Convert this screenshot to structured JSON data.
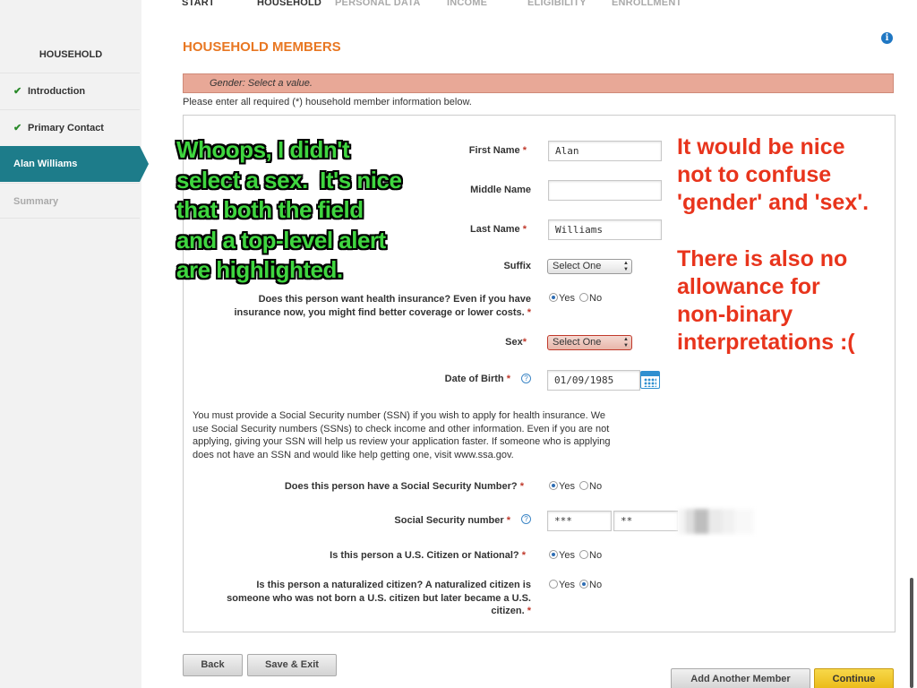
{
  "steps": [
    {
      "label": "START",
      "state": "done"
    },
    {
      "label": "HOUSEHOLD",
      "state": "done"
    },
    {
      "label": "PERSONAL DATA",
      "state": "todo"
    },
    {
      "label": "INCOME",
      "state": "todo"
    },
    {
      "label": "ELIGIBILITY",
      "state": "todo"
    },
    {
      "label": "ENROLLMENT",
      "state": "todo"
    }
  ],
  "sidebar": {
    "title": "HOUSEHOLD",
    "items": [
      {
        "label": "Introduction",
        "icon": "check-icon",
        "state": "complete"
      },
      {
        "label": "Primary Contact",
        "icon": "check-icon",
        "state": "complete"
      },
      {
        "label": "Alan Williams",
        "state": "active"
      },
      {
        "label": "Summary",
        "state": "disabled"
      }
    ]
  },
  "page": {
    "title": "HOUSEHOLD MEMBERS",
    "info_icon": "i",
    "alert": "Gender: Select a value.",
    "intro": "Please enter all required (*) household member information below."
  },
  "form": {
    "first_name": {
      "label": "First Name",
      "value": "Alan"
    },
    "middle_name": {
      "label": "Middle Name",
      "value": ""
    },
    "last_name": {
      "label": "Last Name",
      "value": "Williams"
    },
    "suffix": {
      "label": "Suffix",
      "value": "Select One"
    },
    "health_insurance": {
      "label_line1": "Does this person want health insurance? Even if you have",
      "label_line2": "insurance now, you might find better coverage or lower costs.",
      "selected": "Yes"
    },
    "sex": {
      "label": "Sex",
      "value": "Select One"
    },
    "dob": {
      "label": "Date of Birth",
      "value": "01/09/1985"
    },
    "ssn_note": "You must provide a Social Security number (SSN) if you wish to apply for health insurance. We use Social Security numbers (SSNs) to check income and other information. Even if you are not applying, giving your SSN will help us review your application faster. If someone who is applying does not have an SSN and would like help getting one, visit www.ssa.gov.",
    "has_ssn": {
      "label": "Does this person have a Social Security Number?",
      "selected": "Yes"
    },
    "ssn": {
      "label": "Social Security number",
      "part1": "***",
      "part2": "**"
    },
    "citizen": {
      "label": "Is this person a U.S. Citizen or National?",
      "selected": "Yes"
    },
    "naturalized": {
      "label_line1": "Is this person a naturalized citizen? A naturalized citizen is",
      "label_line2": "someone who was not born a U.S. citizen but later became a U.S.",
      "label_line3": "citizen.",
      "selected": "No"
    },
    "yes_label": "Yes",
    "no_label": "No",
    "required_mark": "*",
    "help_icon": "?"
  },
  "buttons": {
    "back": "Back",
    "save_exit": "Save & Exit",
    "add_member": "Add Another Member",
    "continue": "Continue"
  },
  "annotations": {
    "green": "Whoops, I didn't\nselect a sex.  It's nice\nthat both the field\nand a top-level alert\nare highlighted.",
    "red1": "It would be nice\nnot to confuse\n'gender' and 'sex'.",
    "red2": "There is also no\nallowance for\nnon-binary\ninterpretations :("
  },
  "colors": {
    "accent_orange": "#e87722",
    "sidebar_active": "#1d7c8a",
    "alert_bg": "#e8a897",
    "continue_yellow": "#eab916",
    "annotation_green": "#3fd63f",
    "annotation_red": "#e8341c"
  }
}
